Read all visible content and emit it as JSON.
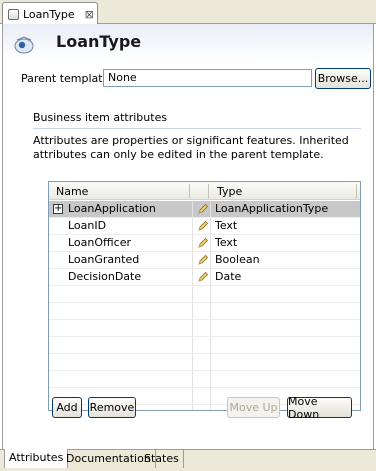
{
  "editor_tab": {
    "title": "LoanType",
    "close_glyph": "⊠"
  },
  "header": {
    "title": "LoanType",
    "icon": "business-object-icon"
  },
  "parent_template": {
    "label": "Parent template",
    "value": "None",
    "browse_label": "Browse..."
  },
  "attributes_section": {
    "title": "Business item attributes",
    "description": "Attributes are properties or significant features. Inherited attributes can only be edited in the parent template."
  },
  "table": {
    "columns": [
      "Name",
      "Type"
    ],
    "rows": [
      {
        "name": "LoanApplication",
        "type": "LoanApplicationType",
        "expandable": true,
        "selected": true
      },
      {
        "name": "LoanID",
        "type": "Text",
        "expandable": false,
        "selected": false
      },
      {
        "name": "LoanOfficer",
        "type": "Text",
        "expandable": false,
        "selected": false
      },
      {
        "name": "LoanGranted",
        "type": "Boolean",
        "expandable": false,
        "selected": false
      },
      {
        "name": "DecisionDate",
        "type": "Date",
        "expandable": false,
        "selected": false
      }
    ],
    "expand_glyph": "+"
  },
  "buttons": {
    "add": "Add",
    "remove": "Remove",
    "move_up": "Move Up",
    "move_down": "Move Down"
  },
  "bottom_tabs": [
    {
      "label": "Attributes",
      "active": true
    },
    {
      "label": "Documentation",
      "active": false
    },
    {
      "label": "States",
      "active": false
    }
  ],
  "colors": {
    "accent_border": "#003c74",
    "selection": "#c8c8c8",
    "field_border": "#7f9db9"
  }
}
